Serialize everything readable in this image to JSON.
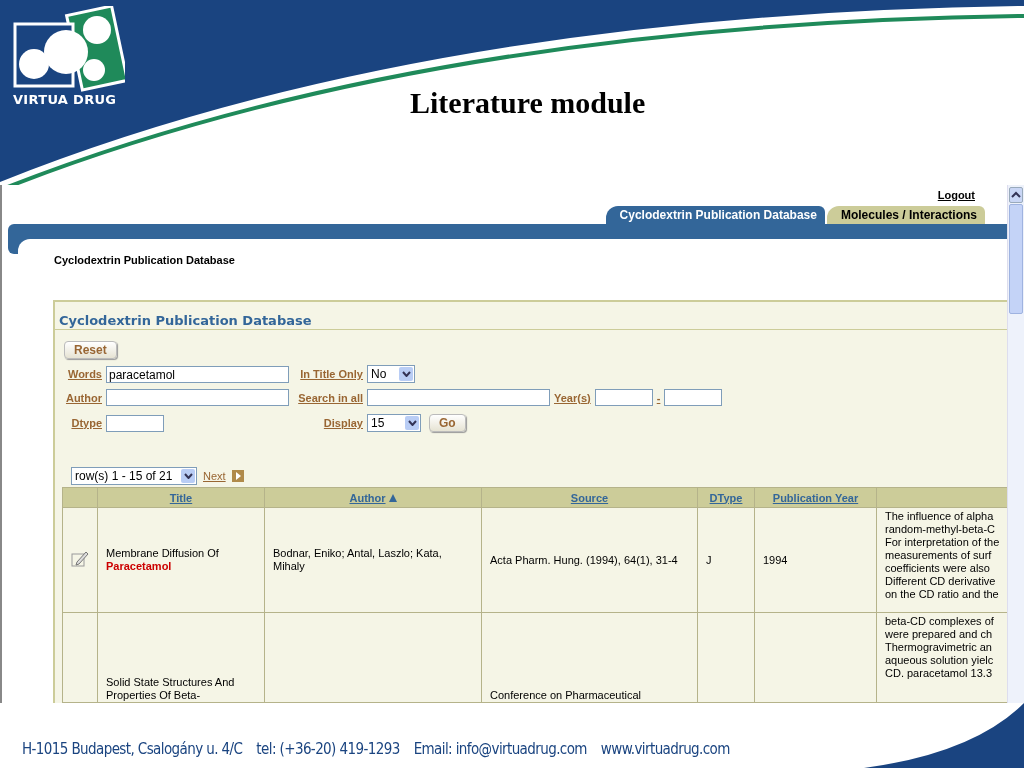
{
  "slide": {
    "logo_text": "VIRTUA DRUG",
    "title": "Literature module"
  },
  "app": {
    "logout": "Logout",
    "tabs": [
      {
        "label": "Cyclodextrin Publication Database",
        "selected": true
      },
      {
        "label": "Molecules / Interactions",
        "selected": false
      }
    ],
    "page_title": "Cyclodextrin Publication Database",
    "panel_title": "Cyclodextrin Publication Database",
    "reset_button": "Reset",
    "words": {
      "label": "Words",
      "value": "paracetamol"
    },
    "in_title_only": {
      "label": "In Title Only",
      "value": "No"
    },
    "author": {
      "label": "Author"
    },
    "search_in_all": {
      "label": "Search in all"
    },
    "years": {
      "label": "Year(s)",
      "separator": "-"
    },
    "dtype": {
      "label": "Dtype"
    },
    "display": {
      "label": "Display",
      "value": "15"
    },
    "go_button": "Go",
    "pager": {
      "range": "row(s) 1 - 15 of 21",
      "next": "Next"
    },
    "table": {
      "columns": [
        {
          "label": "Title",
          "sorted": false
        },
        {
          "label": "Author",
          "sorted": true
        },
        {
          "label": "Source",
          "sorted": false
        },
        {
          "label": "DType",
          "sorted": false
        },
        {
          "label": "Publication Year",
          "sorted": false
        }
      ],
      "rows": [
        {
          "editable": true,
          "title": "Membrane Diffusion Of",
          "title_match": "Paracetamol",
          "author": "Bodnar, Eniko; Antal, Laszlo; Kata, Mihaly",
          "source": "Acta Pharm. Hung. (1994), 64(1), 31-4",
          "dtype": "J",
          "year": "1994",
          "abstract": [
            "The influence of alpha",
            "random-methyl-beta-C",
            "For interpretation of the",
            "measurements of surf",
            "coefficients were also",
            "Different CD derivative",
            "on the CD ratio and the"
          ]
        },
        {
          "editable": false,
          "title": "Solid State Structures And Properties Of Beta-",
          "source": "Conference on Pharmaceutical",
          "abstract": [
            "beta-CD complexes of",
            "were prepared and ch",
            "Thermogravimetric an",
            "aqueous solution yielc",
            "CD. paracetamol 13.3"
          ]
        }
      ]
    }
  },
  "footer": {
    "address": "H-1015 Budapest, Csalogány u. 4/C",
    "phone": "tel: (+36-20) 419-1293",
    "email": "Email: info@virtuadrug.com",
    "web": "www.virtuadrug.com"
  }
}
